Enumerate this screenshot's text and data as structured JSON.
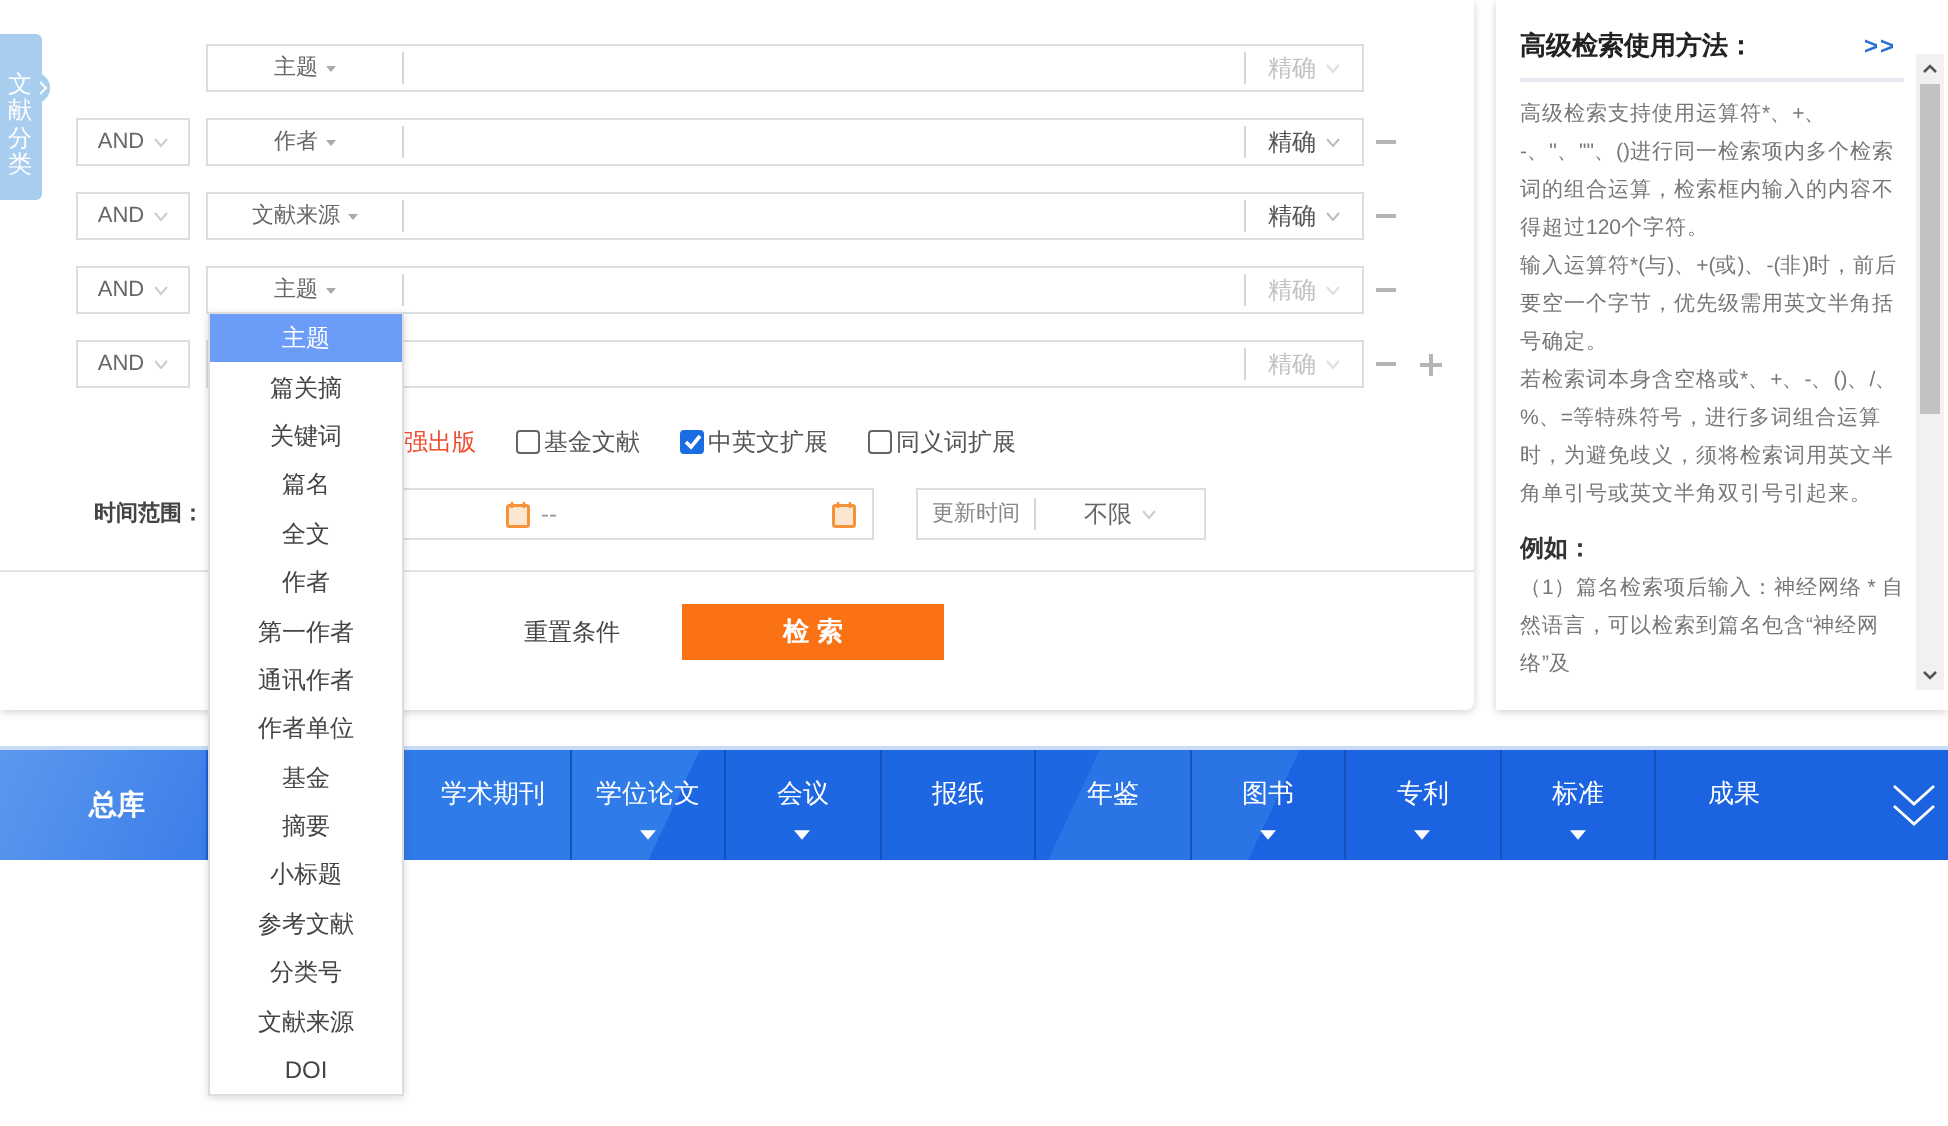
{
  "category_tab": {
    "label": "文献分类"
  },
  "search_rows": [
    {
      "field": "主题",
      "match": "精确",
      "match_enabled": false,
      "removable": false,
      "addable": false
    },
    {
      "logic": "AND",
      "field": "作者",
      "match": "精确",
      "match_enabled": true,
      "removable": true,
      "addable": false
    },
    {
      "logic": "AND",
      "field": "文献来源",
      "match": "精确",
      "match_enabled": true,
      "removable": true,
      "addable": false
    },
    {
      "logic": "AND",
      "field": "主题",
      "match": "精确",
      "match_enabled": false,
      "removable": true,
      "addable": false
    },
    {
      "logic": "AND",
      "match": "精确",
      "match_enabled": false,
      "removable": true,
      "addable": true
    }
  ],
  "options": [
    {
      "kind": "text",
      "label": "强出版"
    },
    {
      "kind": "checkbox",
      "label": "基金文献",
      "checked": false
    },
    {
      "kind": "checkbox",
      "label": "中英文扩展",
      "checked": true
    },
    {
      "kind": "checkbox",
      "label": "同义词扩展",
      "checked": false
    }
  ],
  "time_range": {
    "label": "时间范围：",
    "separator": "--"
  },
  "update_time": {
    "label": "更新时间",
    "value": "不限"
  },
  "actions": {
    "reset": "重置条件",
    "search": "检 索"
  },
  "help": {
    "title": "高级检索使用方法：",
    "more": ">>",
    "paragraphs": [
      "高级检索支持使用运算符*、+、-、''、\"\"、()进行同一检索项内多个检索词的组合运算，检索框内输入的内容不得超过120个字符。",
      "输入运算符*(与)、+(或)、-(非)时，前后要空一个字节，优先级需用英文半角括号确定。",
      "若检索词本身含空格或*、+、-、()、/、%、=等特殊符号，进行多词组合运算时，为避免歧义，须将检索词用英文半角单引号或英文半角双引号引起来。"
    ],
    "example_heading": "例如：",
    "examples": [
      "（1）篇名检索项后输入：神经网络 * 自然语言，可以检索到篇名包含“神经网络”及"
    ]
  },
  "nav": {
    "home": "总库",
    "items": [
      {
        "label": "学术期刊",
        "has_menu": false
      },
      {
        "label": "学位论文",
        "has_menu": true
      },
      {
        "label": "会议",
        "has_menu": true
      },
      {
        "label": "报纸",
        "has_menu": false
      },
      {
        "label": "年鉴",
        "has_menu": false
      },
      {
        "label": "图书",
        "has_menu": true
      },
      {
        "label": "专利",
        "has_menu": true
      },
      {
        "label": "标准",
        "has_menu": true
      },
      {
        "label": "成果",
        "has_menu": false
      }
    ]
  },
  "field_menu": {
    "items": [
      {
        "label": "主题",
        "selected": true
      },
      {
        "label": "篇关摘",
        "selected": false
      },
      {
        "label": "关键词",
        "selected": false
      },
      {
        "label": "篇名",
        "selected": false
      },
      {
        "label": "全文",
        "selected": false
      },
      {
        "label": "作者",
        "selected": false
      },
      {
        "label": "第一作者",
        "selected": false
      },
      {
        "label": "通讯作者",
        "selected": false
      },
      {
        "label": "作者单位",
        "selected": false
      },
      {
        "label": "基金",
        "selected": false
      },
      {
        "label": "摘要",
        "selected": false
      },
      {
        "label": "小标题",
        "selected": false
      },
      {
        "label": "参考文献",
        "selected": false
      },
      {
        "label": "分类号",
        "selected": false
      },
      {
        "label": "文献来源",
        "selected": false
      },
      {
        "label": "DOI",
        "selected": false
      }
    ]
  }
}
